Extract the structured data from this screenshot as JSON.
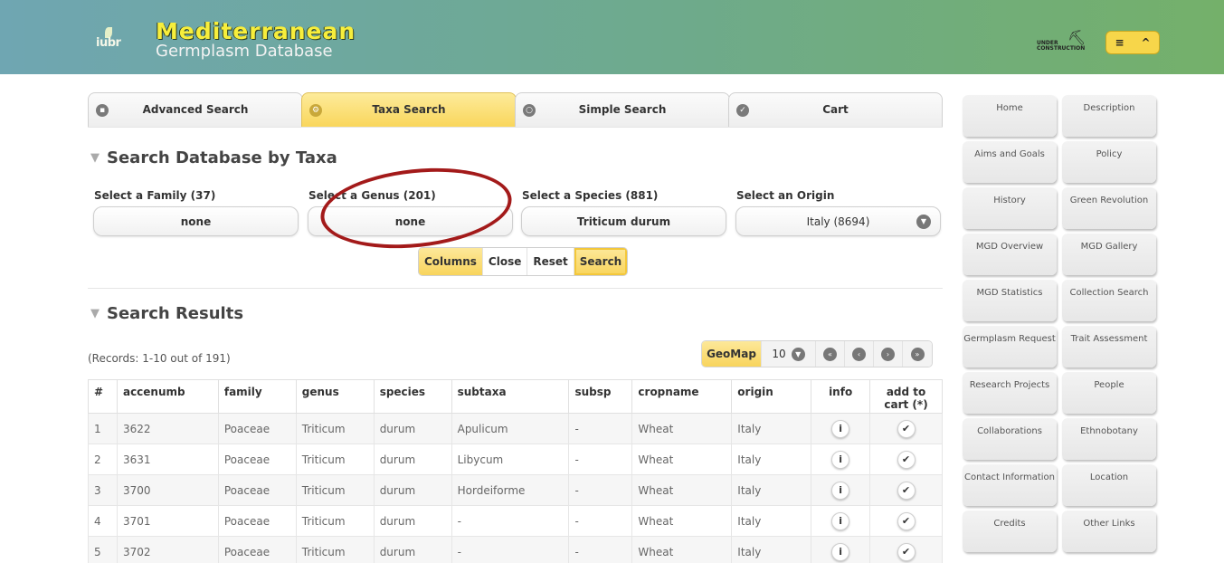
{
  "header": {
    "logo_text": "iubr",
    "title_main": "Mediterranean",
    "title_sub": "Germplasm Database",
    "under_construction_line1": "UNDER",
    "under_construction_line2": "CONSTRUCTION",
    "menu_icon": "≡",
    "collapse_icon": "^"
  },
  "tabs": [
    {
      "label": "Advanced Search",
      "icon": "grid-icon"
    },
    {
      "label": "Taxa Search",
      "icon": "gear-icon",
      "active": true
    },
    {
      "label": "Simple Search",
      "icon": "search-icon"
    },
    {
      "label": "Cart",
      "icon": "check-icon"
    }
  ],
  "taxa_section": {
    "title": "Search Database by Taxa",
    "family_label": "Select a Family (37)",
    "family_value": "none",
    "genus_label": "Select a Genus (201)",
    "genus_value": "none",
    "species_label": "Select a Species (881)",
    "species_value": "Triticum durum",
    "origin_label": "Select an Origin",
    "origin_value": "Italy (8694)"
  },
  "actions": {
    "columns": "Columns",
    "close": "Close",
    "reset": "Reset",
    "search": "Search"
  },
  "results_section": {
    "title": "Search Results",
    "records": "(Records: 1-10 out of 191)",
    "geomap": "GeoMap",
    "per_page": "10"
  },
  "table": {
    "headers": [
      "#",
      "accenumb",
      "family",
      "genus",
      "species",
      "subtaxa",
      "subsp",
      "cropname",
      "origin",
      "info",
      "add to cart (*)"
    ],
    "rows": [
      [
        "1",
        "3622",
        "Poaceae",
        "Triticum",
        "durum",
        "Apulicum",
        "-",
        "Wheat",
        "Italy"
      ],
      [
        "2",
        "3631",
        "Poaceae",
        "Triticum",
        "durum",
        "Libycum",
        "-",
        "Wheat",
        "Italy"
      ],
      [
        "3",
        "3700",
        "Poaceae",
        "Triticum",
        "durum",
        "Hordeiforme",
        "-",
        "Wheat",
        "Italy"
      ],
      [
        "4",
        "3701",
        "Poaceae",
        "Triticum",
        "durum",
        "-",
        "-",
        "Wheat",
        "Italy"
      ],
      [
        "5",
        "3702",
        "Poaceae",
        "Triticum",
        "durum",
        "-",
        "-",
        "Wheat",
        "Italy"
      ]
    ],
    "info_icon": "i",
    "cart_icon": "✔"
  },
  "sidebar": {
    "items": [
      "Home",
      "Description",
      "Aims and Goals",
      "Policy",
      "History",
      "Green Revolution",
      "MGD Overview",
      "MGD Gallery",
      "MGD Statistics",
      "Collection Search",
      "Germplasm Request",
      "Trait Assessment",
      "Research Projects",
      "People",
      "Collaborations",
      "Ethnobotany",
      "Contact Information",
      "Location",
      "Credits",
      "Other Links"
    ]
  }
}
